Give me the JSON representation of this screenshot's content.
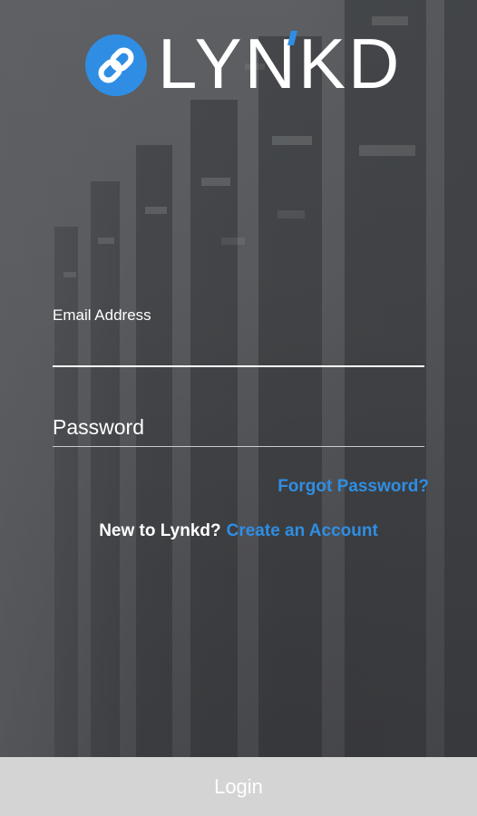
{
  "brand": {
    "logo_text": "LYNKD",
    "logo_icon": "chain-link-icon",
    "accent_color": "#2f8ee3"
  },
  "form": {
    "email_label": "Email Address",
    "email_value": "",
    "password_placeholder": "Password",
    "password_value": ""
  },
  "links": {
    "forgot_password": "Forgot Password?",
    "signup_prompt": "New to Lynkd?",
    "create_account": "Create an Account"
  },
  "actions": {
    "login_label": "Login",
    "login_bg_color": "#d4d4d4"
  }
}
